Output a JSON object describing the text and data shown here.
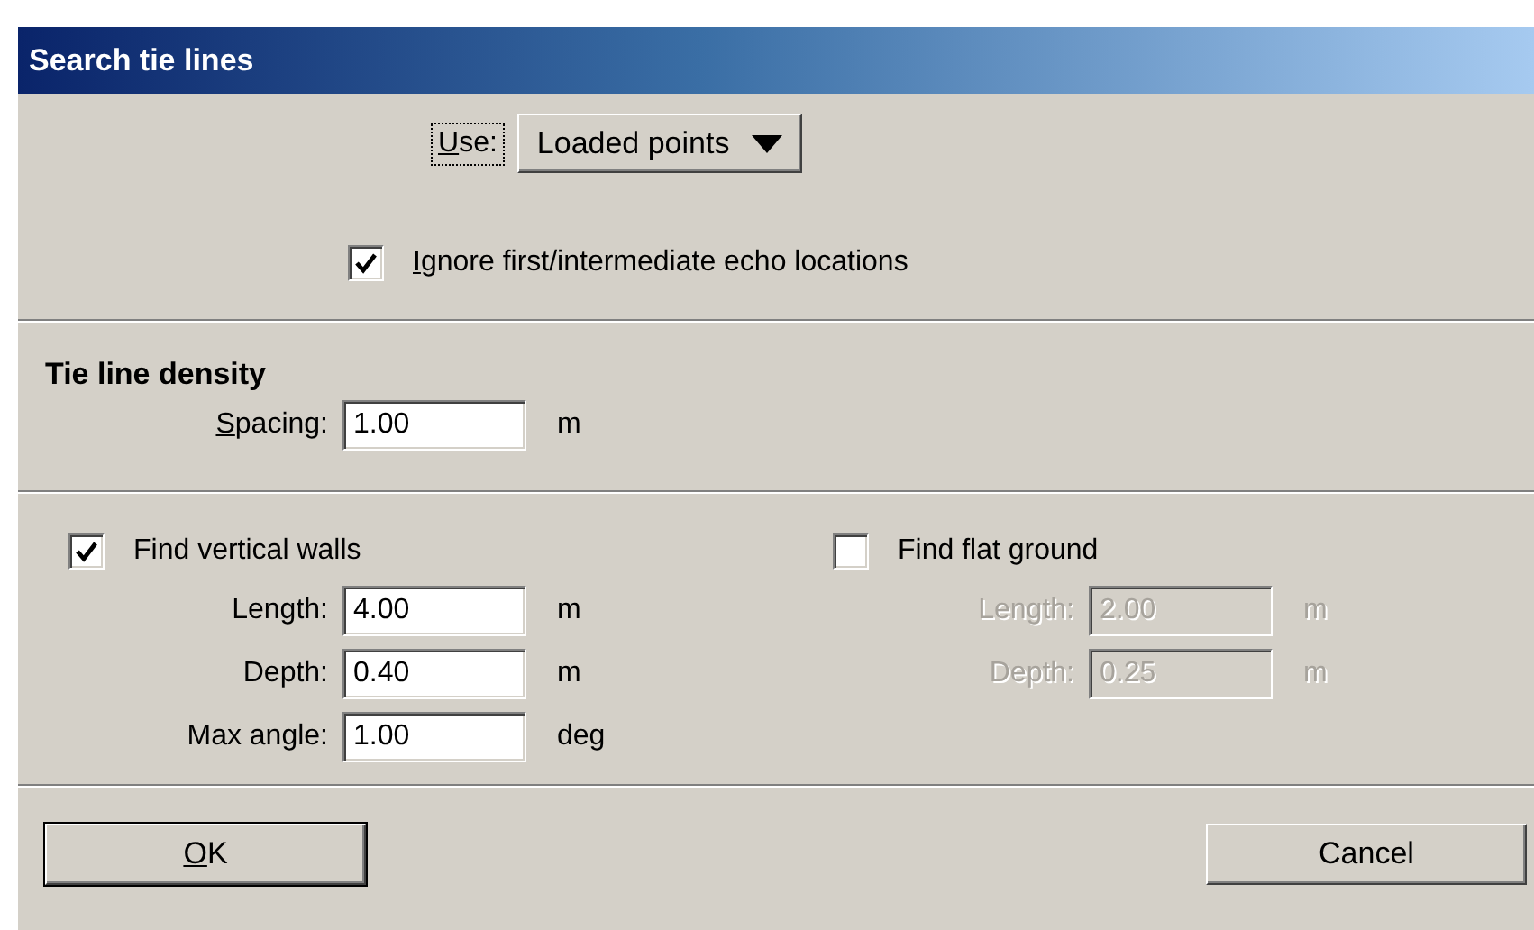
{
  "window": {
    "title": "Search tie lines"
  },
  "source": {
    "label": "Use:",
    "mnemonic": true,
    "focused": true,
    "value": "Loaded points"
  },
  "ignore_echo": {
    "label": "Ignore first/intermediate echo locations",
    "mnemonic": true,
    "checked": true
  },
  "density": {
    "heading": "Tie line density",
    "fields": [
      {
        "label": "Spacing:",
        "mnemonic": true,
        "value": "1.00",
        "unit": "m",
        "disabled": false
      }
    ]
  },
  "groups": [
    {
      "label": "Find vertical walls",
      "checked": true,
      "fields": [
        {
          "label": "Length:",
          "mnemonic": false,
          "value": "4.00",
          "unit": "m",
          "disabled": false
        },
        {
          "label": "Depth:",
          "mnemonic": false,
          "value": "0.40",
          "unit": "m",
          "disabled": false
        },
        {
          "label": "Max angle:",
          "mnemonic": false,
          "value": "1.00",
          "unit": "deg",
          "disabled": false
        }
      ]
    },
    {
      "label": "Find flat ground",
      "checked": false,
      "fields": [
        {
          "label": "Length:",
          "mnemonic": false,
          "value": "2.00",
          "unit": "m",
          "disabled": true
        },
        {
          "label": "Depth:",
          "mnemonic": false,
          "value": "0.25",
          "unit": "m",
          "disabled": true
        }
      ]
    }
  ],
  "buttons": [
    {
      "label": "OK",
      "mnemonic": true,
      "default": true
    },
    {
      "label": "Cancel",
      "mnemonic": false,
      "default": false
    }
  ]
}
